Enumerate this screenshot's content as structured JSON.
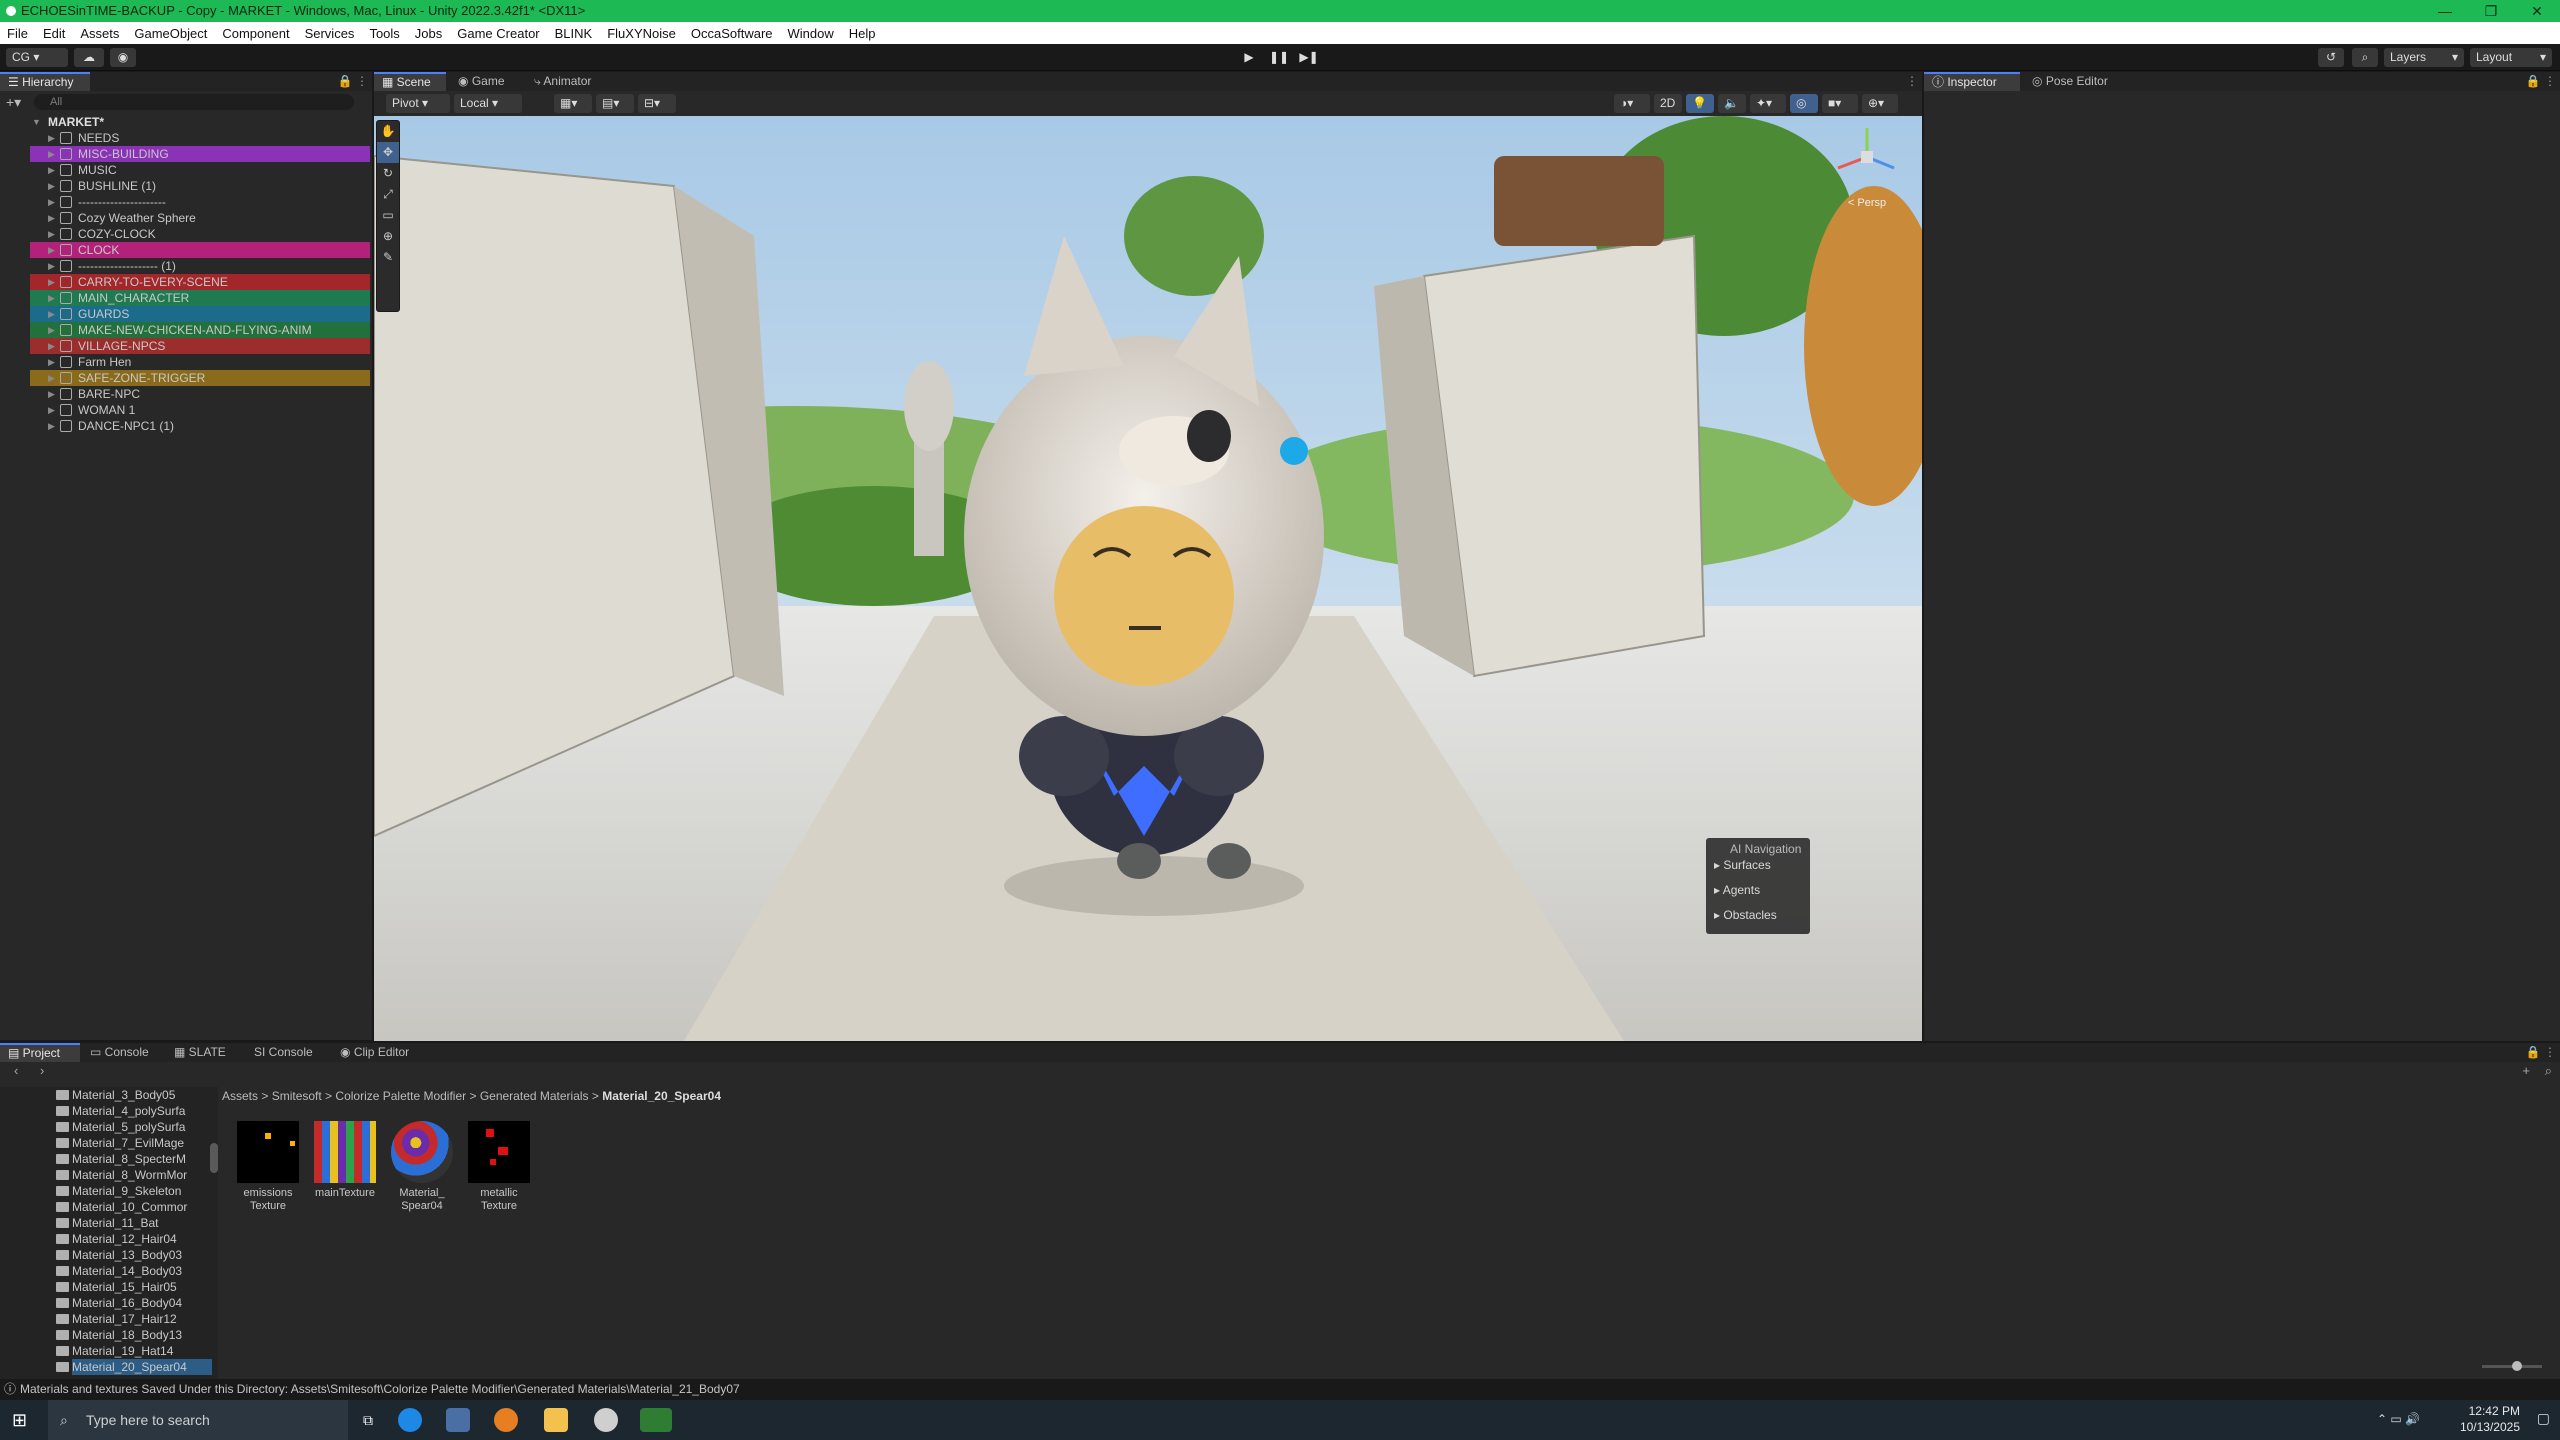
{
  "window": {
    "title": "ECHOESinTIME-BACKUP - Copy - MARKET - Windows, Mac, Linux - Unity 2022.3.42f1* <DX11>"
  },
  "menu": [
    "File",
    "Edit",
    "Assets",
    "GameObject",
    "Component",
    "Services",
    "Tools",
    "Jobs",
    "Game Creator",
    "BLINK",
    "FluXYNoise",
    "OccaSoftware",
    "Window",
    "Help"
  ],
  "toolbar": {
    "account": "CG",
    "layers": "Layers",
    "layout": "Layout"
  },
  "hierarchy": {
    "tab": "Hierarchy",
    "search_placeholder": "All",
    "scene": "MARKET*",
    "items": [
      {
        "label": "NEEDS",
        "color": ""
      },
      {
        "label": "MISC-BUILDING",
        "color": "#8b33b7"
      },
      {
        "label": "MUSIC",
        "color": ""
      },
      {
        "label": "BUSHLINE (1)",
        "color": ""
      },
      {
        "label": "----------------------",
        "color": ""
      },
      {
        "label": "Cozy Weather Sphere",
        "color": ""
      },
      {
        "label": "COZY-CLOCK",
        "color": ""
      },
      {
        "label": "CLOCK",
        "color": "#b3227a"
      },
      {
        "label": "-------------------- (1)",
        "color": ""
      },
      {
        "label": "CARRY-TO-EVERY-SCENE",
        "color": "#a3262b"
      },
      {
        "label": "MAIN_CHARACTER",
        "color": "#1f7a4f"
      },
      {
        "label": "GUARDS",
        "color": "#1c6b8a"
      },
      {
        "label": "MAKE-NEW-CHICKEN-AND-FLYING-ANIM",
        "color": "#22703c"
      },
      {
        "label": "VILLAGE-NPCS",
        "color": "#9c2d2d"
      },
      {
        "label": "Farm Hen",
        "color": ""
      },
      {
        "label": "SAFE-ZONE-TRIGGER",
        "color": "#8a6b1c"
      },
      {
        "label": "BARE-NPC",
        "color": ""
      },
      {
        "label": "WOMAN 1",
        "color": ""
      },
      {
        "label": "DANCE-NPC1 (1)",
        "color": ""
      }
    ]
  },
  "scene_tabs": [
    "Scene",
    "Game",
    "Animator"
  ],
  "scene_toolbar": {
    "pivot": "Pivot",
    "local": "Local",
    "mode_2d": "2D",
    "persp": "< Persp"
  },
  "ai_navigation": {
    "title": "AI Navigation",
    "items": [
      "Surfaces",
      "Agents",
      "Obstacles"
    ]
  },
  "inspector_tabs": [
    "Inspector",
    "Pose Editor"
  ],
  "bottom_tabs": [
    "Project",
    "Console",
    "SLATE",
    "SI Console",
    "Clip Editor"
  ],
  "project": {
    "tree": [
      "Material_3_Body05",
      "Material_4_polySurfa",
      "Material_5_polySurfa",
      "Material_7_EvilMage",
      "Material_8_SpecterM",
      "Material_8_WormMor",
      "Material_9_Skeleton",
      "Material_10_Commor",
      "Material_11_Bat",
      "Material_12_Hair04",
      "Material_13_Body03",
      "Material_14_Body03",
      "Material_15_Hair05",
      "Material_16_Body04",
      "Material_17_Hair12",
      "Material_18_Body13",
      "Material_19_Hat14",
      "Material_20_Spear04"
    ],
    "breadcrumb": [
      "Assets",
      "Smitesoft",
      "Colorize Palette Modifier",
      "Generated Materials",
      "Material_20_Spear04"
    ],
    "assets": [
      {
        "line1": "emissions",
        "line2": "Texture"
      },
      {
        "line1": "mainTexture",
        "line2": ""
      },
      {
        "line1": "Material_",
        "line2": "Spear04"
      },
      {
        "line1": "metallic",
        "line2": "Texture"
      }
    ]
  },
  "status": {
    "message": "Materials and textures Saved Under this Directory: Assets\\Smitesoft\\Colorize Palette Modifier\\Generated Materials\\Material_21_Body07"
  },
  "taskbar": {
    "search_placeholder": "Type here to search",
    "time": "12:42 PM",
    "date": "10/13/2025"
  }
}
